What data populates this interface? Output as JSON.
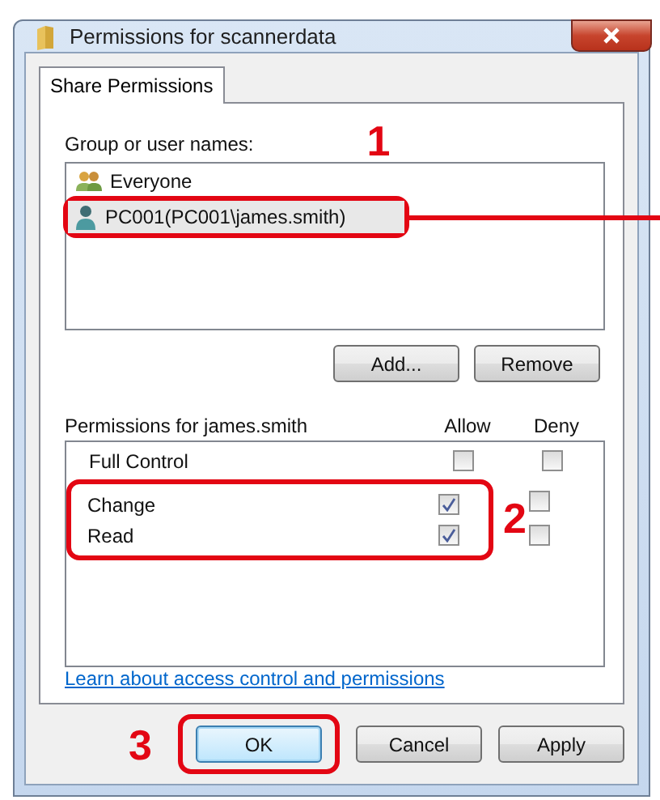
{
  "window": {
    "title": "Permissions for scannerdata"
  },
  "tabs": [
    {
      "label": "Share Permissions",
      "selected": true
    }
  ],
  "users": {
    "label": "Group or user names:",
    "callout": "1",
    "items": [
      {
        "name": "Everyone",
        "kind": "group",
        "selected": false
      },
      {
        "name": "PC001(PC001\\james.smith)",
        "kind": "user",
        "selected": true
      }
    ]
  },
  "user_buttons": [
    "Add...",
    "Remove"
  ],
  "permissions": {
    "label": "Permissions for  james.smith",
    "columns": [
      "Allow",
      "Deny"
    ],
    "callout": "2",
    "rows": [
      {
        "name": "Full Control",
        "allow": false,
        "deny": false,
        "highlighted": false
      },
      {
        "name": "Change",
        "allow": true,
        "deny": false,
        "highlighted": true
      },
      {
        "name": "Read",
        "allow": true,
        "deny": false,
        "highlighted": true
      }
    ]
  },
  "link": "Learn about access control and permissions",
  "buttons": [
    {
      "label": "OK",
      "focused": true,
      "callout": "3"
    },
    {
      "label": "Cancel",
      "focused": false
    },
    {
      "label": "Apply",
      "focused": false
    }
  ]
}
